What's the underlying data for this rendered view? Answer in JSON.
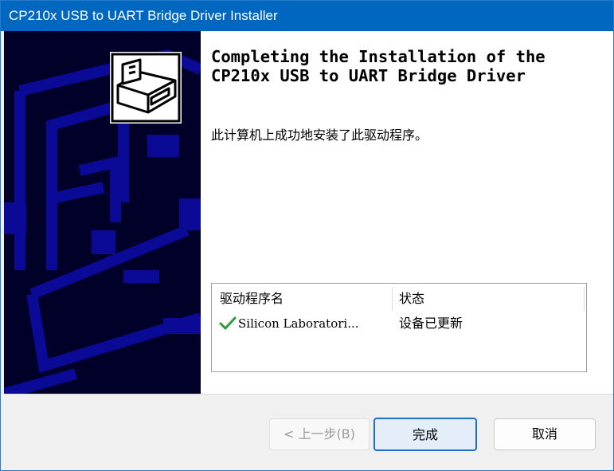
{
  "window": {
    "title": "CP210x USB to UART Bridge Driver Installer"
  },
  "wizard": {
    "heading_line1": "Completing the Installation of the",
    "heading_line2": "CP210x USB to UART Bridge Driver",
    "message": "此计算机上成功地安装了此驱动程序。"
  },
  "driver_list": {
    "columns": [
      "驱动程序名",
      "状态"
    ],
    "rows": [
      {
        "name": "Silicon Laboratori...",
        "status": "设备已更新",
        "icon": "green-check-icon"
      }
    ]
  },
  "buttons": {
    "back": "< 上一步(B)",
    "finish": "完成",
    "cancel": "取消"
  },
  "colors": {
    "titlebar": "#0067c0",
    "sidebar_background": "#000029",
    "sidebar_shapes": "#0a0a96",
    "check_green": "#2e9c3a",
    "default_button_border": "#1f6fc8"
  },
  "icons": {
    "logo": "hardware-box-icon",
    "row_status": "green-check-icon"
  }
}
